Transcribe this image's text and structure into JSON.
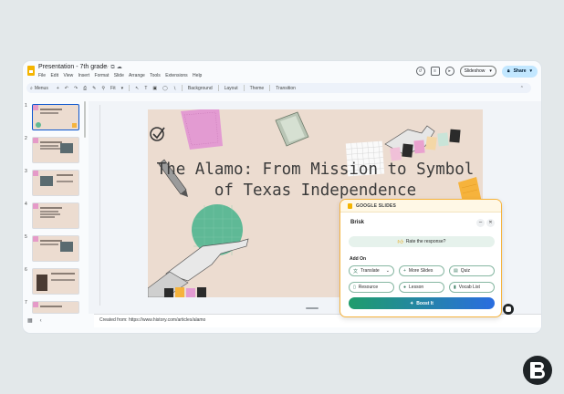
{
  "window": {
    "doc_title": "Presentation - 7th grade",
    "menu": [
      "File",
      "Edit",
      "View",
      "Insert",
      "Format",
      "Slide",
      "Arrange",
      "Tools",
      "Extensions",
      "Help"
    ],
    "slideshow_label": "Slideshow",
    "share_label": "Share"
  },
  "toolbar": {
    "menus_label": "Menus",
    "zoom_label": "Fit",
    "background_label": "Background",
    "layout_label": "Layout",
    "theme_label": "Theme",
    "transition_label": "Transition"
  },
  "filmstrip": {
    "slide_numbers": [
      "1",
      "2",
      "3",
      "4",
      "5",
      "6",
      "7"
    ],
    "selected": "1"
  },
  "slide": {
    "title": "The Alamo: From Mission to Symbol of Texas Independence",
    "sticker_school": "School",
    "sticker_cool": "Cool"
  },
  "notes": {
    "text": "Created from: https://www.history.com/articles/alamo"
  },
  "brisk": {
    "header": "GOOGLE SLIDES",
    "title": "Brisk",
    "rate_prompt": "Rate the response?",
    "add_on_label": "Add On",
    "buttons": {
      "translate": "Translate",
      "more_slides": "More Slides",
      "quiz": "Quiz",
      "resource": "Resource",
      "lesson": "Lesson",
      "vocab_list": "Vocab List"
    },
    "boost_label": "Boost It"
  },
  "colors": {
    "accent_blue": "#c2e7ff",
    "brisk_border": "#f6b33c",
    "slide_bg": "#ecdcd0"
  }
}
